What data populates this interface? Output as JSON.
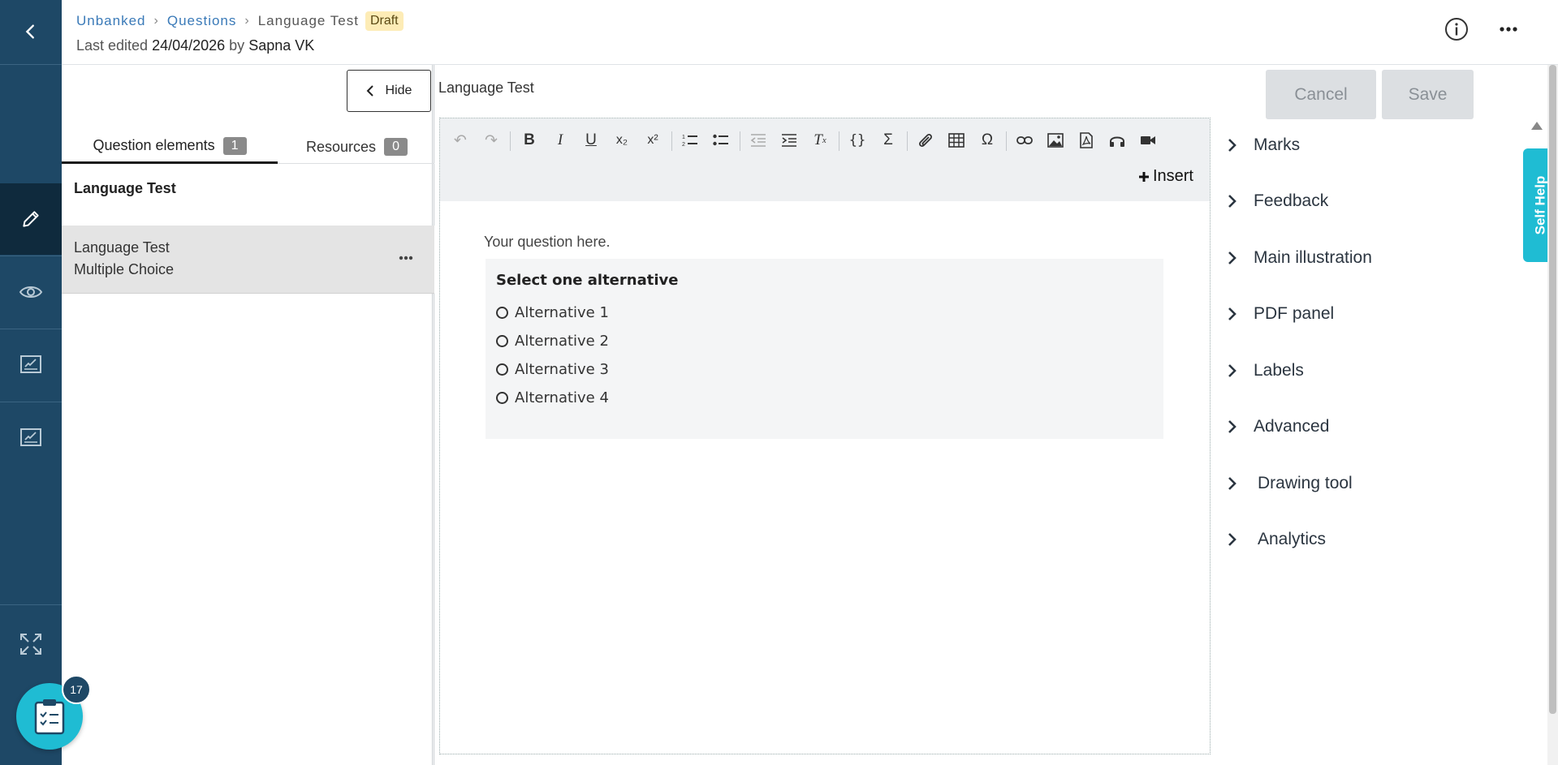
{
  "breadcrumb": {
    "items": [
      "Unbanked",
      "Questions"
    ],
    "current": "Language Test",
    "status": "Draft"
  },
  "edited": {
    "prefix": "Last edited ",
    "date": "24/04/2026",
    "by": " by ",
    "user": "Sapna VK"
  },
  "left_panel": {
    "hide_label": "Hide",
    "tabs": [
      {
        "label": "Question elements",
        "count": "1"
      },
      {
        "label": "Resources",
        "count": "0"
      }
    ],
    "title": "Language Test",
    "element": {
      "line1": "Language Test",
      "line2": "Multiple Choice"
    }
  },
  "editor": {
    "title": "Language Test",
    "insert_label": "Insert",
    "question_text": "Your question here.",
    "alternatives_heading": "Select one alternative",
    "alternatives": [
      "Alternative 1",
      "Alternative 2",
      "Alternative 3",
      "Alternative 4"
    ]
  },
  "actions": {
    "cancel": "Cancel",
    "save": "Save"
  },
  "accordion": [
    "Marks",
    "Feedback",
    "Main illustration",
    "PDF panel",
    "Labels",
    "Advanced",
    "Drawing tool",
    "Analytics"
  ],
  "self_help": "Self Help",
  "notification_count": "17",
  "colors": {
    "rail": "#1e4866",
    "accent": "#1fbcd3",
    "link": "#3a7ab8",
    "draft_bg": "#fdecb6"
  }
}
